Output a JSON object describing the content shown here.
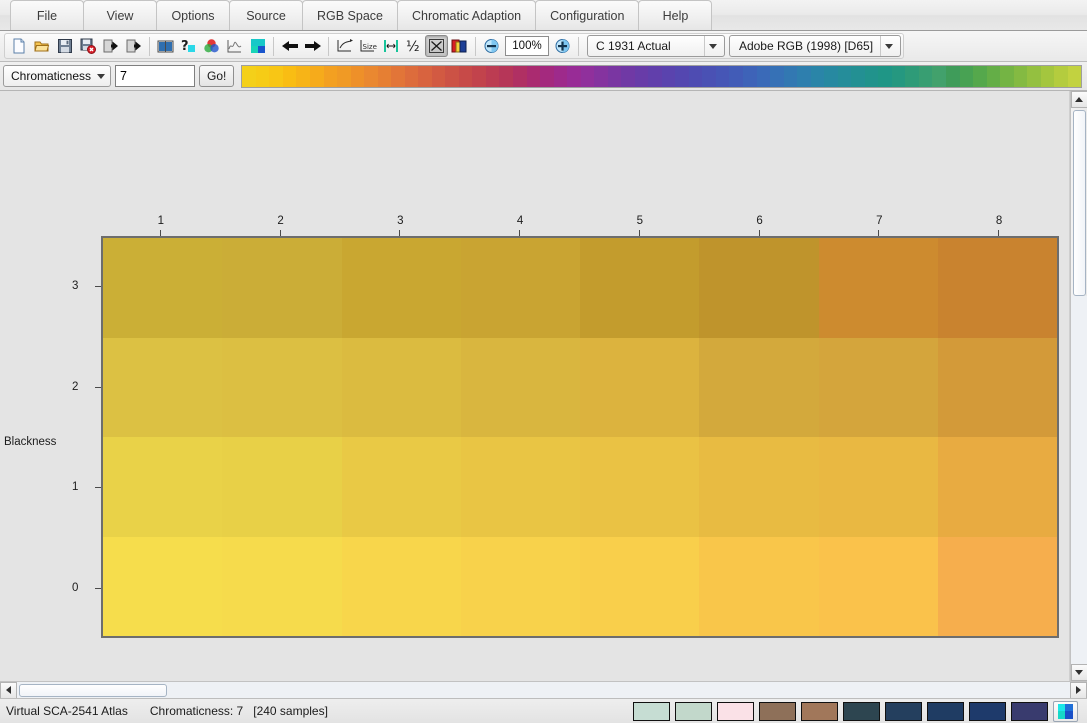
{
  "menu": {
    "items": [
      {
        "label": "File",
        "name": "menu-file"
      },
      {
        "label": "View",
        "name": "menu-view"
      },
      {
        "label": "Options",
        "name": "menu-options"
      },
      {
        "label": "Source",
        "name": "menu-source"
      },
      {
        "label": "RGB Space",
        "name": "menu-rgb-space"
      },
      {
        "label": "Chromatic Adaption",
        "name": "menu-chromatic-adaption"
      },
      {
        "label": "Configuration",
        "name": "menu-configuration"
      },
      {
        "label": "Help",
        "name": "menu-help"
      }
    ]
  },
  "toolbar": {
    "zoom_value": "100%",
    "observer_combo": "C 1931 Actual",
    "rgb_space_combo": "Adobe RGB (1998) [D65]",
    "icons": [
      "new-document-icon",
      "open-folder-icon",
      "save-icon",
      "save-close-icon",
      "import-icon",
      "export-icon",
      "book-icon",
      "help-icon",
      "color-wheel-icon",
      "curve-chart-icon",
      "color-blocks-icon",
      "back-arrow-icon",
      "forward-arrow-icon",
      "rotate-icon",
      "size-icon",
      "fit-width-icon",
      "half-size-icon",
      "fit-screen-icon",
      "layers-icon",
      "zoom-out-icon",
      "zoom-in-icon"
    ]
  },
  "attribute_bar": {
    "selector_label": "Chromaticness",
    "value": "7",
    "go_label": "Go!",
    "hue_strip_colors": [
      "#f4d019",
      "#f6cc16",
      "#f8c615",
      "#f9bd13",
      "#f7b417",
      "#f6ab1b",
      "#f3a021",
      "#f09a25",
      "#ee9029",
      "#ea8830",
      "#e67f33",
      "#e27538",
      "#dd6c3c",
      "#d8633f",
      "#d25a42",
      "#cc5245",
      "#c74a48",
      "#c2434c",
      "#bc3c52",
      "#b63658",
      "#b03063",
      "#aa2b70",
      "#a4297e",
      "#9e2a8b",
      "#982c96",
      "#90309c",
      "#85339f",
      "#7a36a2",
      "#7039a5",
      "#683ca8",
      "#613fab",
      "#5a43ae",
      "#5447b0",
      "#4e4cb2",
      "#4a51b4",
      "#4656b6",
      "#425cb7",
      "#3e63b8",
      "#3a6ab8",
      "#3671b6",
      "#3278b2",
      "#2e7fae",
      "#2a85a8",
      "#2789a1",
      "#258d9a",
      "#239093",
      "#21938c",
      "#1f9686",
      "#259880",
      "#2e9b78",
      "#389e72",
      "#42a16c",
      "#3f9c5a",
      "#48a253",
      "#55a84c",
      "#64ae47",
      "#74b444",
      "#84ba42",
      "#94c040",
      "#a4c63e",
      "#b4cc3e",
      "#c2d240"
    ]
  },
  "chart_data": {
    "type": "heatmap",
    "title": "Virtual SCA-2541 Atlas",
    "xlabel": "",
    "ylabel": "Blackness",
    "x_ticks": [
      "1",
      "2",
      "3",
      "4",
      "5",
      "6",
      "7",
      "8"
    ],
    "y_ticks": [
      "0",
      "1",
      "2",
      "3"
    ],
    "xlim": [
      0,
      8.4
    ],
    "ylim": [
      -0.5,
      3.5
    ],
    "grid": false,
    "legend": "none",
    "rows": [
      {
        "blackness": 3,
        "colors": [
          "#cbaf36",
          "#cbad37",
          "#c9a731",
          "#c9a432",
          "#c39c2d",
          "#bf942c",
          "#cd8b2f",
          "#c9832f"
        ]
      },
      {
        "blackness": 2,
        "colors": [
          "#dcc143",
          "#dcbf42",
          "#dbbb40",
          "#d9b63f",
          "#dcb33e",
          "#d3a93c",
          "#d4a53c",
          "#d39a39"
        ]
      },
      {
        "blackness": 1,
        "colors": [
          "#e9d248",
          "#e8d047",
          "#e9c945",
          "#e9c544",
          "#eac244",
          "#e8bb42",
          "#e9b842",
          "#e8ab41"
        ]
      },
      {
        "blackness": 0,
        "colors": [
          "#f6dd4c",
          "#f6db4c",
          "#f8d64b",
          "#f8d24b",
          "#f9cf4b",
          "#f9c64a",
          "#fac24b",
          "#f6ae4d"
        ]
      }
    ]
  },
  "status": {
    "atlas_name": "Virtual SCA-2541 Atlas",
    "attribute_text": "Chromaticness: 7",
    "samples_text": "[240 samples]",
    "swatches": [
      "#c6ddd3",
      "#c2d8cb",
      "#fae1e7",
      "#8e7059",
      "#a1775a",
      "#2d4550",
      "#243f5e",
      "#1f3c63",
      "#1e3a6b",
      "#393b6e"
    ],
    "picker_name": "color-picker-button"
  }
}
